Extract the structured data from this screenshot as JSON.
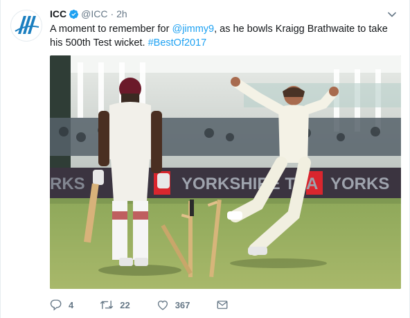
{
  "tweet": {
    "author_name": "ICC",
    "handle": "@ICC",
    "separator": "·",
    "time": "2h",
    "text_before": "A moment to remember for ",
    "mention": "@jimmy9",
    "text_middle": ", as he bowls Kraigg Brathwaite to take his 500th Test wicket. ",
    "hashtag": "#BestOf2017",
    "media_banner_text": "YORKSHIRE TEA"
  },
  "actions": {
    "reply_count": "4",
    "retweet_count": "22",
    "like_count": "367"
  },
  "colors": {
    "accent": "#1da1f2",
    "muted": "#657786",
    "text": "#14171a",
    "logo_blue": "#1b7fc0"
  },
  "icons": {
    "avatar": "icc-logo-icon",
    "verified": "verified-badge-icon",
    "menu": "chevron-down-icon",
    "reply": "reply-icon",
    "retweet": "retweet-icon",
    "like": "heart-icon",
    "dm": "envelope-icon"
  }
}
